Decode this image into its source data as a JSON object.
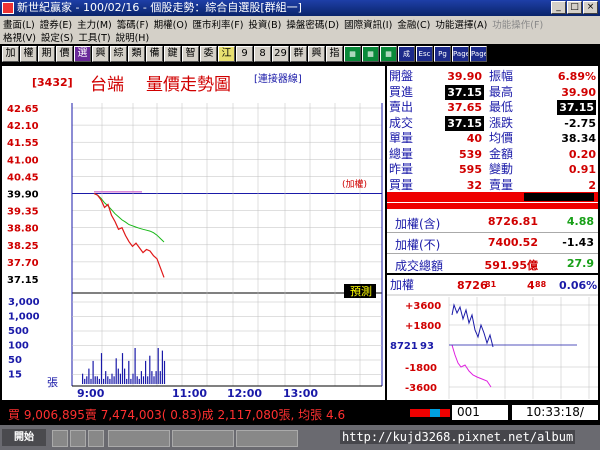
{
  "window": {
    "title": "新世紀贏家 - 100/02/16 - 個股走勢：綜合自選股[群組一]"
  },
  "menu_row1": [
    "畫面(L)",
    "證券(E)",
    "主力(M)",
    "籌碼(F)",
    "期權(O)",
    "匯市利率(F)",
    "投資(B)",
    "操盤密碼(D)",
    "國際資訊(I)",
    "金融(C)",
    "功能選擇(A)"
  ],
  "menu_row1_dim": "功能操作(F)",
  "menu_row2": [
    "格視(V)",
    "設定(S)",
    "工具(T)",
    "說明(H)"
  ],
  "toolbar": [
    "加",
    "權",
    "期",
    "價",
    "選",
    "興",
    "綜",
    "類",
    "備",
    "鍵",
    "智",
    "委",
    "江",
    "9",
    "8",
    "29",
    "群",
    "興",
    "指",
    "▦",
    "▦",
    "▦",
    "成",
    "Esc",
    "Pg",
    "Page",
    "Page"
  ],
  "chart": {
    "stock_code": "[3432]",
    "stock_name": "台端",
    "title": "量價走勢圖",
    "link": "[連接器線]",
    "ref_label": "(加權)",
    "gauge_label": "預測",
    "price_labels": [
      "42.65",
      "42.10",
      "41.55",
      "41.00",
      "40.45",
      "39.90",
      "39.35",
      "38.80",
      "38.25",
      "37.70",
      "37.15"
    ],
    "volume_labels": [
      "3,000",
      "1,000",
      "500",
      "100",
      "50",
      "15"
    ],
    "volume_unit": "張",
    "time_labels": [
      "9:00",
      "11:00",
      "12:00",
      "13:00"
    ]
  },
  "chart_data": {
    "type": "line",
    "title": "台端 量價走勢圖",
    "y_range": [
      37.15,
      42.65
    ],
    "reference_price": 39.9,
    "price_series": [
      39.9,
      39.85,
      39.7,
      39.45,
      39.55,
      39.2,
      39.0,
      38.75,
      38.8,
      38.55,
      38.35,
      38.2,
      38.3,
      38.15,
      38.0,
      38.1,
      38.05,
      37.9,
      37.8,
      37.5,
      37.2
    ],
    "avg_series": [
      39.9,
      39.85,
      39.75,
      39.6,
      39.5,
      39.38,
      39.25,
      39.15,
      39.05,
      38.98,
      38.9,
      38.86,
      38.82,
      38.78,
      38.75,
      38.72,
      38.69,
      38.64,
      38.56,
      38.45,
      38.34
    ],
    "volume_series": [
      4,
      2,
      3,
      6,
      2,
      9,
      3,
      3,
      2,
      12,
      2,
      5,
      3,
      2,
      4,
      3,
      10,
      6,
      4,
      12,
      6,
      2,
      9,
      2,
      4,
      14,
      3,
      2,
      5,
      3,
      9,
      3,
      11,
      5,
      3,
      5,
      14,
      5,
      13,
      9
    ]
  },
  "quote": {
    "rows": [
      {
        "l": "開盤",
        "v": "39.90",
        "l2": "振幅",
        "v2": "6.89%"
      },
      {
        "l": "買進",
        "v": "37.15",
        "l2": "最高",
        "v2": "39.90"
      },
      {
        "l": "賣出",
        "v": "37.65",
        "l2": "最低",
        "v2": "37.15"
      },
      {
        "l": "成交",
        "v": "37.15",
        "l2": "漲跌",
        "v2": "-2.75"
      },
      {
        "l": "單量",
        "v": "40",
        "l2": "均價",
        "v2": "38.34"
      },
      {
        "l": "總量",
        "v": "539",
        "l2": "金額",
        "v2": "0.20"
      },
      {
        "l": "昨量",
        "v": "595",
        "l2": "變動",
        "v2": "0.91"
      },
      {
        "l": "買量",
        "v": "32",
        "l2": "賣量",
        "v2": "2"
      }
    ],
    "index_rows": [
      {
        "l": "加權(含)",
        "v": "8726.81",
        "c": "4.88"
      },
      {
        "l": "加權(不)",
        "v": "7400.52",
        "c": "-1.43"
      },
      {
        "l": "成交總額",
        "v": "591.95億",
        "c": "27.9"
      }
    ]
  },
  "mini": {
    "label": "加權",
    "value": "8726",
    "value_dec": "81",
    "change": "4",
    "change_dec": "88",
    "pct": "0.06%",
    "mid": "8721",
    "mid_dec": "93",
    "labels": [
      "+3600",
      "+1800",
      "-1800",
      "-3600"
    ]
  },
  "status": {
    "text": "買 9,006,895賣 7,474,003( 0.83)成 2,117,080張, 均張 4.6",
    "code": "001",
    "clock": "10:33:18/"
  },
  "taskbar": {
    "start": "開始",
    "watermark": "http://kujd3268.pixnet.net/album"
  }
}
